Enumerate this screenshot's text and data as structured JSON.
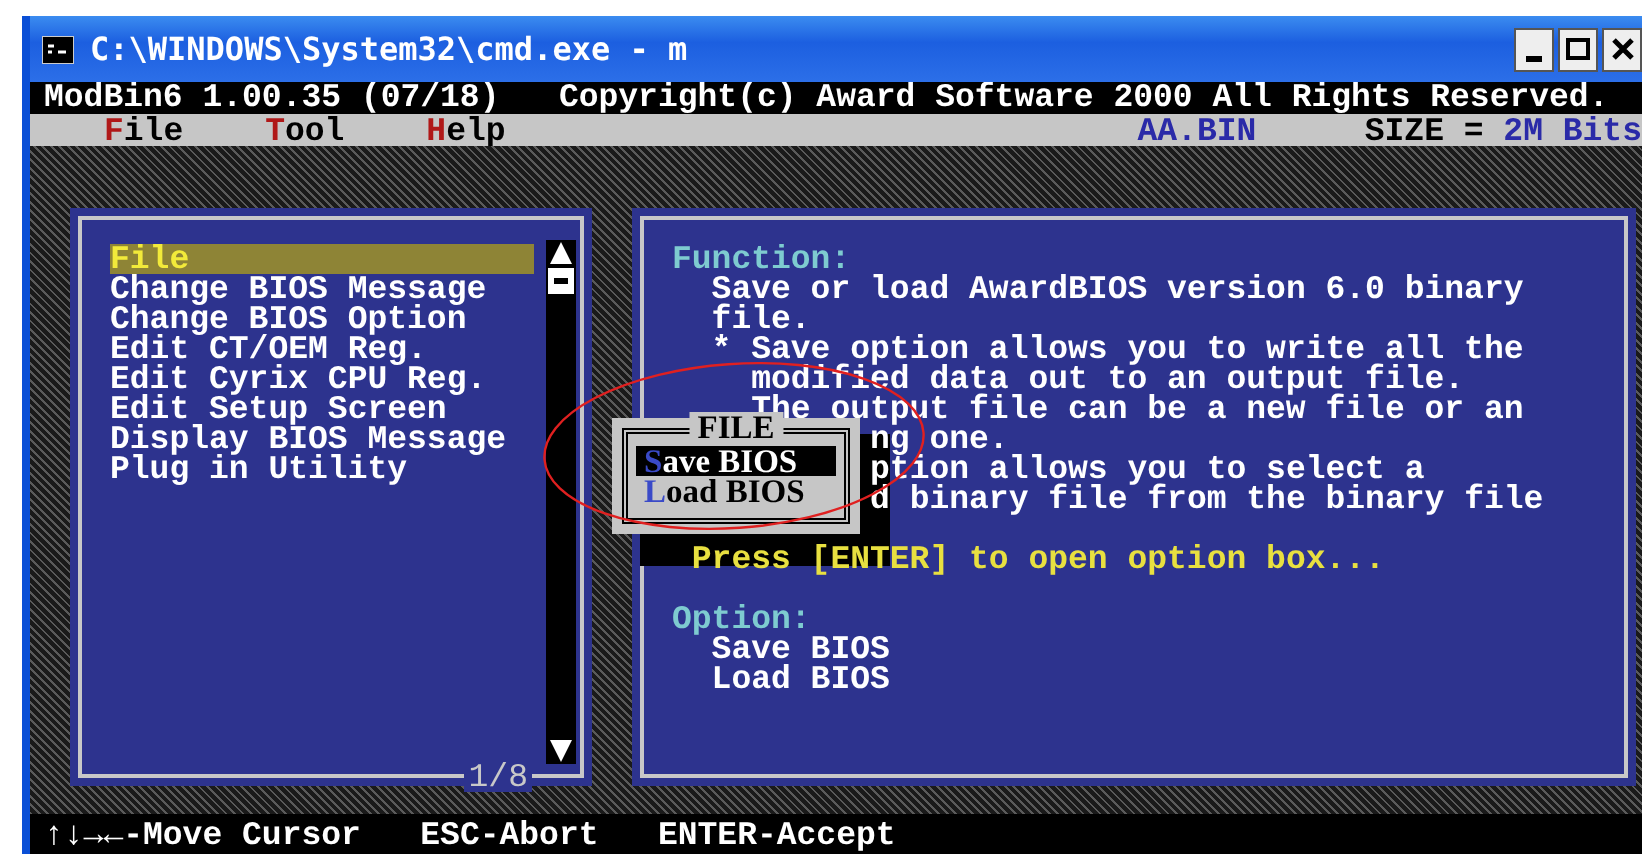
{
  "window": {
    "title": "C:\\WINDOWS\\System32\\cmd.exe - m"
  },
  "header": {
    "program": "ModBin6 1.00.35 (07/18)",
    "copyright": "Copyright(c) Award Software 2000 All Rights Reserved."
  },
  "menu": {
    "items": [
      {
        "label": "File"
      },
      {
        "label": "Tool"
      },
      {
        "label": "Help"
      }
    ],
    "file_name": "AA.BIN",
    "size_label": "SIZE =",
    "size_value": "2M Bits"
  },
  "function_list": {
    "items": [
      {
        "label": "File",
        "selected": true
      },
      {
        "label": "Change BIOS Message",
        "selected": false
      },
      {
        "label": "Change BIOS Option",
        "selected": false
      },
      {
        "label": "Edit CT/OEM Reg.",
        "selected": false
      },
      {
        "label": "Edit Cyrix CPU Reg.",
        "selected": false
      },
      {
        "label": "Edit Setup Screen",
        "selected": false
      },
      {
        "label": "Display BIOS Message",
        "selected": false
      },
      {
        "label": "Plug in Utility",
        "selected": false
      }
    ],
    "position": "1/8"
  },
  "info_panel": {
    "lines": [
      {
        "kind": "heading",
        "text": "Function:"
      },
      {
        "kind": "body",
        "text": "Save or load AwardBIOS version 6.0 binary"
      },
      {
        "kind": "body",
        "text": "file."
      },
      {
        "kind": "body",
        "text": "* Save option allows you to write all the"
      },
      {
        "kind": "continuation",
        "text": "modified data out to an output file."
      },
      {
        "kind": "continuation",
        "text": "The output file can be a new file or an"
      },
      {
        "kind": "partial",
        "text": "ng one."
      },
      {
        "kind": "partial",
        "text": "ption allows you to select a"
      },
      {
        "kind": "partial",
        "text": "d binary file from the binary file"
      },
      {
        "kind": "blank"
      },
      {
        "kind": "prompt",
        "text": "Press [ENTER] to open option box..."
      },
      {
        "kind": "blank"
      },
      {
        "kind": "heading",
        "text": "Option:"
      },
      {
        "kind": "body",
        "text": "Save BIOS"
      },
      {
        "kind": "body",
        "text": "Load BIOS"
      }
    ]
  },
  "popup": {
    "title": "FILE",
    "items": [
      {
        "label": "Save BIOS",
        "selected": true
      },
      {
        "label": "Load BIOS",
        "selected": false
      }
    ]
  },
  "status_bar": [
    "↑↓→←-Move Cursor",
    "ESC-Abort",
    "ENTER-Accept"
  ]
}
